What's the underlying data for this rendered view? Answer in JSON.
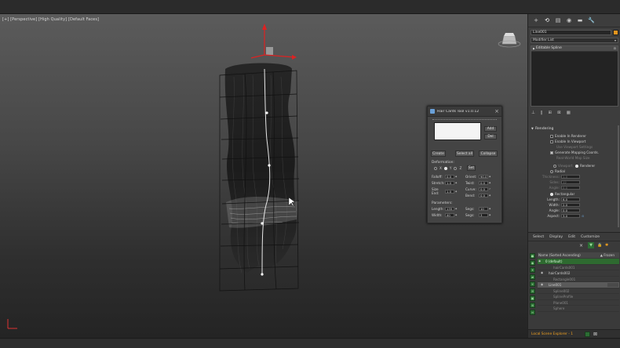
{
  "viewport": {
    "label_parts": [
      "[+]",
      "[Perspective]",
      "[High Quality]",
      "[Default Faces]"
    ]
  },
  "dialog": {
    "title": "Hair Cards Tool v1.0.12",
    "add": "Add",
    "del": "Del",
    "create": "Create",
    "select_all": "Select all",
    "collapse": "Collapse",
    "deformation_label": "Deformation:",
    "axis_x": "X",
    "axis_y": "Y",
    "axis_z": "Z",
    "axis_selected": "Y",
    "set": "Set",
    "fields_left": [
      {
        "label": "Falloff:",
        "value": "0.0"
      },
      {
        "label": "Stretch:",
        "value": "1.0"
      },
      {
        "label": "Size End:",
        "value": "1.0"
      }
    ],
    "fields_right": [
      {
        "label": "Orient:",
        "value": "90.0"
      },
      {
        "label": "Twist:",
        "value": "0.0"
      },
      {
        "label": "Curve:",
        "value": "0.0"
      },
      {
        "label": "Bend:",
        "value": "0.0"
      }
    ],
    "parameters_label": "Parameters:",
    "params_left": [
      {
        "label": "Length:",
        "value": "135"
      },
      {
        "label": "Width:",
        "value": "40"
      }
    ],
    "params_right": [
      {
        "label": "Segs:",
        "value": "10"
      },
      {
        "label": "Segs:",
        "value": "3"
      }
    ]
  },
  "cmdpanel": {
    "tabs": [
      "+",
      "⟲",
      "▤",
      "◉",
      "▬",
      "🔧"
    ],
    "object_name": "Line001",
    "object_color": "#e6951e",
    "modifier_list": "Modifier List",
    "stack_items": [
      "Editable Spline"
    ],
    "rendering_header": "Rendering",
    "checks": [
      {
        "label": "Enable In Renderer",
        "on": false,
        "dim": false
      },
      {
        "label": "Enable In Viewport",
        "on": false,
        "dim": false
      },
      {
        "label": "Use Viewport Settings",
        "on": false,
        "dim": true
      },
      {
        "label": "Generate Mapping Coords.",
        "on": true,
        "dim": false
      },
      {
        "label": "Real-World Map Size",
        "on": false,
        "dim": true
      }
    ],
    "viewport_radio": "Viewport",
    "renderer_radio": "Renderer",
    "radial_label": "Radial",
    "rectangular_label": "Rectangular",
    "radial_fields": [
      {
        "label": "Thickness:",
        "value": "1.0"
      },
      {
        "label": "Sides:",
        "value": "12"
      },
      {
        "label": "Angle:",
        "value": "0.0"
      }
    ],
    "rect_fields": [
      {
        "label": "Length:",
        "value": "6.0"
      },
      {
        "label": "Width:",
        "value": "2.0"
      },
      {
        "label": "Angle:",
        "value": "0.0"
      },
      {
        "label": "Aspect:",
        "value": "3.0"
      }
    ]
  },
  "explorer": {
    "menu": [
      "Select",
      "Display",
      "Edit",
      "Customize"
    ],
    "header_name": "Name (Sorted Ascending)",
    "header_frozen": "▲ Frozen",
    "rows": [
      {
        "name": "0 (default)",
        "indent": 0,
        "selected": false,
        "dim": false
      },
      {
        "name": "hairCards001",
        "indent": 2,
        "selected": false,
        "dim": true
      },
      {
        "name": "hairCards002",
        "indent": 1,
        "selected": false,
        "dim": false
      },
      {
        "name": "Rectangle001",
        "indent": 2,
        "selected": false,
        "dim": true
      },
      {
        "name": "Line001",
        "indent": 1,
        "selected": true,
        "dim": false
      },
      {
        "name": "Spline002",
        "indent": 2,
        "selected": false,
        "dim": true
      },
      {
        "name": "SplineProfile",
        "indent": 2,
        "selected": false,
        "dim": true
      },
      {
        "name": "Plane001",
        "indent": 2,
        "selected": false,
        "dim": true
      },
      {
        "name": "Sphere",
        "indent": 2,
        "selected": false,
        "dim": true
      }
    ],
    "footer": "Local Scene Explorer - 1"
  }
}
